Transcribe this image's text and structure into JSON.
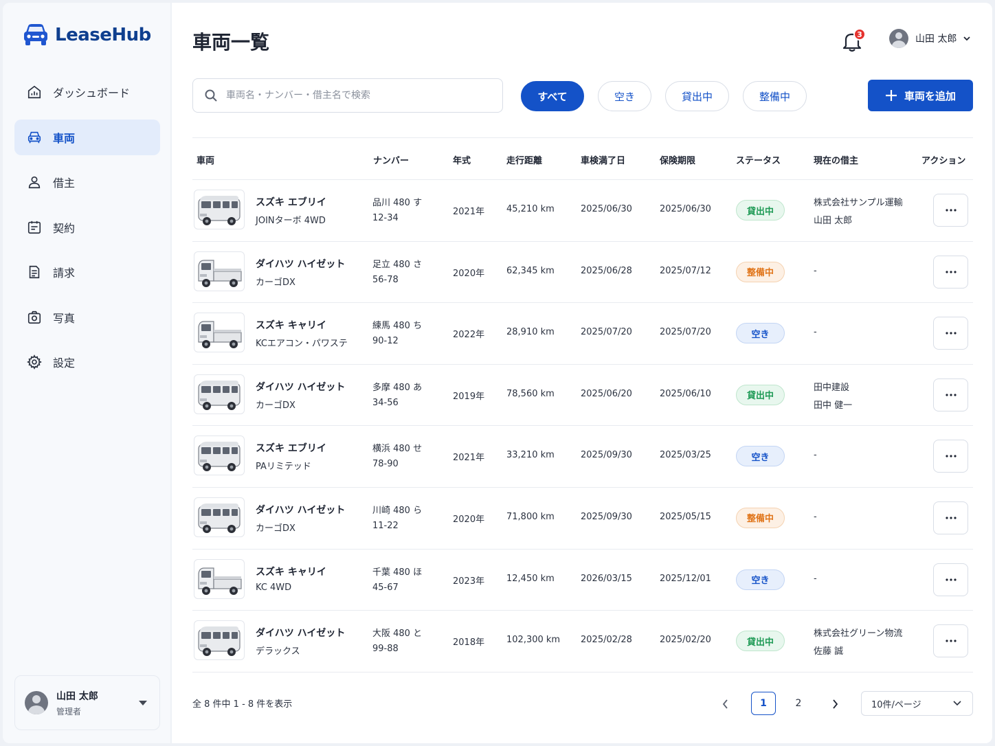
{
  "app": {
    "name": "LeaseHub"
  },
  "sidebar": {
    "items": [
      {
        "label": "ダッシュボード",
        "icon": "dashboard-icon"
      },
      {
        "label": "車両",
        "icon": "car-icon",
        "active": true
      },
      {
        "label": "借主",
        "icon": "user-icon"
      },
      {
        "label": "契約",
        "icon": "contract-icon"
      },
      {
        "label": "請求",
        "icon": "invoice-icon"
      },
      {
        "label": "写真",
        "icon": "camera-icon"
      },
      {
        "label": "設定",
        "icon": "gear-icon"
      }
    ],
    "user": {
      "name": "山田 太郎",
      "role": "管理者"
    }
  },
  "header": {
    "title": "車両一覧",
    "notification_count": "3",
    "user_name": "山田 太郎"
  },
  "toolbar": {
    "search_placeholder": "車両名・ナンバー・借主名で検索",
    "filters": [
      "すべて",
      "空き",
      "貸出中",
      "整備中"
    ],
    "active_filter": "すべて",
    "add_label": "車両を追加"
  },
  "table": {
    "headers": [
      "車両",
      "ナンバー",
      "年式",
      "走行距離",
      "車検満了日",
      "保険期限",
      "ステータス",
      "現在の借主",
      "アクション"
    ],
    "rows": [
      {
        "name": "スズキ エブリイ",
        "grade": "JOINターボ 4WD",
        "plate1": "品川 480 す",
        "plate2": "12-34",
        "year": "2021年",
        "mileage": "45,210 km",
        "inspection": "2025/06/30",
        "insurance": "2025/06/30",
        "status": "貸出中",
        "borrower1": "株式会社サンプル運輸",
        "borrower2": "山田 太郎",
        "vehicle_type": "van"
      },
      {
        "name": "ダイハツ ハイゼット",
        "grade": "カーゴDX",
        "plate1": "足立 480 さ",
        "plate2": "56-78",
        "year": "2020年",
        "mileage": "62,345 km",
        "inspection": "2025/06/28",
        "insurance": "2025/07/12",
        "status": "整備中",
        "borrower1": "-",
        "borrower2": "",
        "vehicle_type": "truck"
      },
      {
        "name": "スズキ キャリイ",
        "grade": "KCエアコン・パワステ",
        "plate1": "練馬 480 ち",
        "plate2": "90-12",
        "year": "2022年",
        "mileage": "28,910 km",
        "inspection": "2025/07/20",
        "insurance": "2025/07/20",
        "status": "空き",
        "borrower1": "-",
        "borrower2": "",
        "vehicle_type": "truck"
      },
      {
        "name": "ダイハツ ハイゼット",
        "grade": "カーゴDX",
        "plate1": "多摩 480 あ",
        "plate2": "34-56",
        "year": "2019年",
        "mileage": "78,560 km",
        "inspection": "2025/06/20",
        "insurance": "2025/06/10",
        "status": "貸出中",
        "borrower1": "田中建設",
        "borrower2": "田中 健一",
        "vehicle_type": "van"
      },
      {
        "name": "スズキ エブリイ",
        "grade": "PAリミテッド",
        "plate1": "横浜 480 せ",
        "plate2": "78-90",
        "year": "2021年",
        "mileage": "33,210 km",
        "inspection": "2025/09/30",
        "insurance": "2025/03/25",
        "status": "空き",
        "borrower1": "-",
        "borrower2": "",
        "vehicle_type": "van"
      },
      {
        "name": "ダイハツ ハイゼット",
        "grade": "カーゴDX",
        "plate1": "川崎 480 ら",
        "plate2": "11-22",
        "year": "2020年",
        "mileage": "71,800 km",
        "inspection": "2025/09/30",
        "insurance": "2025/05/15",
        "status": "整備中",
        "borrower1": "-",
        "borrower2": "",
        "vehicle_type": "van"
      },
      {
        "name": "スズキ キャリイ",
        "grade": "KC 4WD",
        "plate1": "千葉 480 ほ",
        "plate2": "45-67",
        "year": "2023年",
        "mileage": "12,450 km",
        "inspection": "2026/03/15",
        "insurance": "2025/12/01",
        "status": "空き",
        "borrower1": "-",
        "borrower2": "",
        "vehicle_type": "truck"
      },
      {
        "name": "ダイハツ ハイゼット",
        "grade": "デラックス",
        "plate1": "大阪 480 と",
        "plate2": "99-88",
        "year": "2018年",
        "mileage": "102,300 km",
        "inspection": "2025/02/28",
        "insurance": "2025/02/20",
        "status": "貸出中",
        "borrower1": "株式会社グリーン物流",
        "borrower2": "佐藤 誠",
        "vehicle_type": "van"
      }
    ]
  },
  "pagination": {
    "summary": "全 8 件中 1 - 8 件を表示",
    "pages": [
      "1",
      "2"
    ],
    "current": "1",
    "per_page": "10件/ページ"
  },
  "colors": {
    "primary": "#1452c8",
    "lease": "#1e9a55",
    "maintenance": "#e07419",
    "free": "#1452c8",
    "brand": "#0f3f8f"
  }
}
